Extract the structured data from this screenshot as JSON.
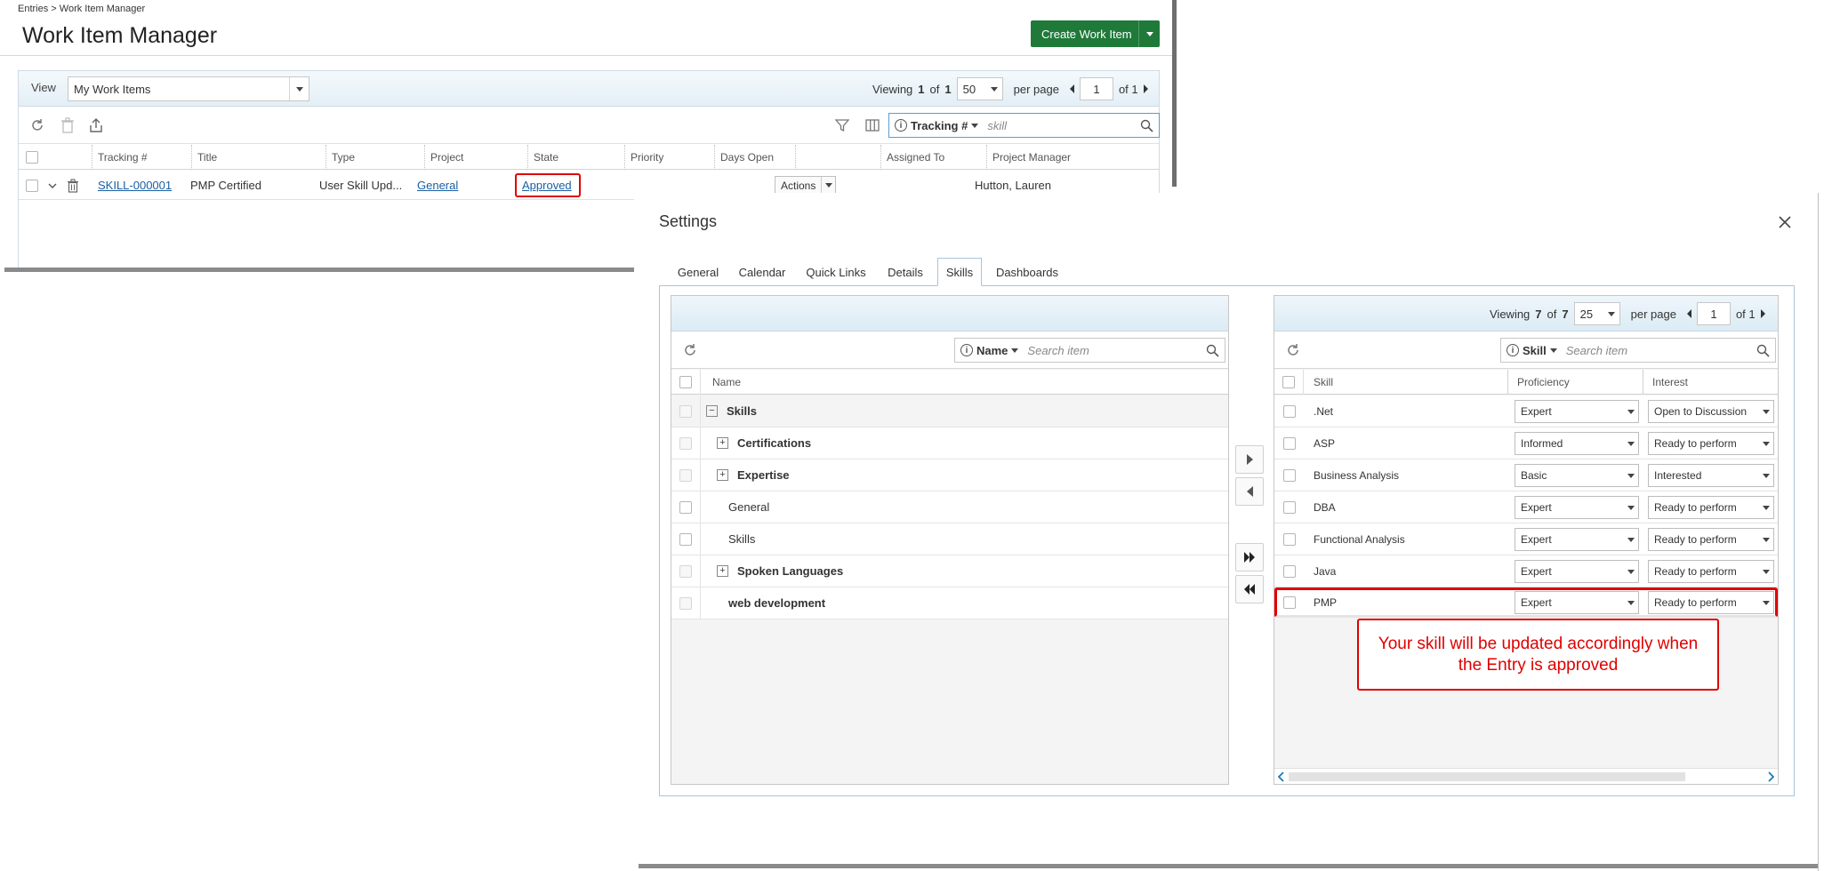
{
  "background_window": {
    "breadcrumb": "Entries > Work Item Manager",
    "title": "Work Item Manager",
    "create_button": "Create Work Item",
    "view_label": "View",
    "view_value": "My Work Items",
    "pager": {
      "viewing": "Viewing",
      "current": "1",
      "of_word": "of",
      "total": "1",
      "per_page_value": "50",
      "per_page_label": "per page",
      "page": "1",
      "of_pages": "of 1"
    },
    "search": {
      "field": "Tracking #",
      "value": "skill"
    },
    "columns": [
      "Tracking #",
      "Title",
      "Type",
      "Project",
      "State",
      "Priority",
      "Days Open",
      "",
      "Assigned To",
      "Project Manager"
    ],
    "row": {
      "tracking": "SKILL-000001",
      "title": "PMP Certified",
      "type": "User Skill Upd...",
      "project": "General",
      "state": "Approved",
      "actions": "Actions",
      "project_manager": "Hutton, Lauren"
    }
  },
  "dialog": {
    "title": "Settings",
    "tabs": [
      "General",
      "Calendar",
      "Quick Links",
      "Details",
      "Skills",
      "Dashboards"
    ],
    "active_tab": "Skills",
    "left_panel": {
      "search_field": "Name",
      "search_placeholder": "Search item",
      "column": "Name",
      "tree": [
        {
          "label": "Skills",
          "expander": "minus",
          "bold": true
        },
        {
          "label": "Certifications",
          "expander": "plus",
          "bold": true
        },
        {
          "label": "Expertise",
          "expander": "plus",
          "bold": true
        },
        {
          "label": "General",
          "expander": "none",
          "bold": false
        },
        {
          "label": "Skills",
          "expander": "none",
          "bold": false
        },
        {
          "label": "Spoken Languages",
          "expander": "plus",
          "bold": true
        },
        {
          "label": "web development",
          "expander": "none",
          "bold": true
        }
      ]
    },
    "right_panel": {
      "pager": {
        "viewing": "Viewing",
        "current": "7",
        "of_word": "of",
        "total": "7",
        "per_page_value": "25",
        "per_page_label": "per page",
        "page": "1",
        "of_pages": "of 1"
      },
      "search_field": "Skill",
      "search_placeholder": "Search item",
      "columns": [
        "Skill",
        "Proficiency",
        "Interest"
      ],
      "rows": [
        {
          "skill": ".Net",
          "proficiency": "Expert",
          "interest": "Open to Discussion"
        },
        {
          "skill": "ASP",
          "proficiency": "Informed",
          "interest": "Ready to perform"
        },
        {
          "skill": "Business Analysis",
          "proficiency": "Basic",
          "interest": "Interested"
        },
        {
          "skill": "DBA",
          "proficiency": "Expert",
          "interest": "Ready to perform"
        },
        {
          "skill": "Functional Analysis",
          "proficiency": "Expert",
          "interest": "Ready to perform"
        },
        {
          "skill": "Java",
          "proficiency": "Expert",
          "interest": "Ready to perform"
        },
        {
          "skill": "PMP",
          "proficiency": "Expert",
          "interest": "Ready to perform"
        }
      ]
    },
    "callout": "Your skill will be updated accordingly when the Entry is approved"
  },
  "colors": {
    "create_button": "#1f7a3a",
    "annotation_red": "#e00000",
    "link_blue": "#1a5fa3",
    "search_border": "#5b9bd5"
  }
}
